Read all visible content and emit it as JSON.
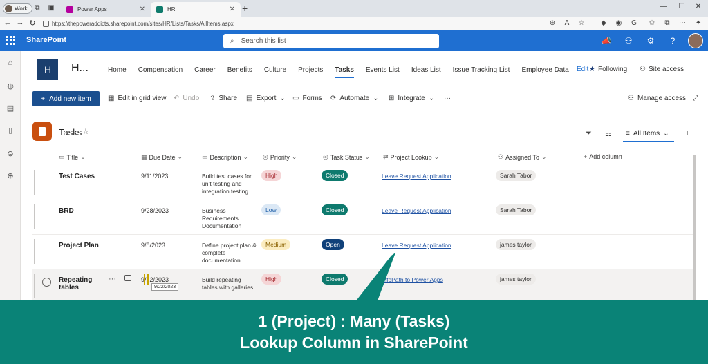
{
  "browser": {
    "profile_label": "Work",
    "tabs": [
      {
        "label": "Power Apps",
        "color": "#b4009e"
      },
      {
        "label": "HR",
        "color": "#0f7b6c"
      }
    ],
    "url": "https://thepoweraddicts.sharepoint.com/sites/HR/Lists/Tasks/AllItems.aspx"
  },
  "suite": {
    "app_name": "SharePoint",
    "search_placeholder": "Search this list"
  },
  "site": {
    "logo_letter": "H",
    "name": "H...",
    "nav": [
      "Home",
      "Compensation",
      "Career",
      "Benefits",
      "Culture",
      "Projects",
      "Tasks",
      "Events List",
      "Ideas List",
      "Issue Tracking List",
      "Employee Data",
      "···"
    ],
    "active_nav": "Tasks",
    "edit": "Edit",
    "following": "Following",
    "site_access": "Site access"
  },
  "commands": {
    "add_new_item": "Add new item",
    "edit_grid": "Edit in grid view",
    "undo": "Undo",
    "share": "Share",
    "export": "Export",
    "forms": "Forms",
    "automate": "Automate",
    "integrate": "Integrate",
    "more": "···",
    "manage_access": "Manage access"
  },
  "list": {
    "title": "Tasks",
    "view": "All Items",
    "columns": {
      "title": "Title",
      "due": "Due Date",
      "desc": "Description",
      "priority": "Priority",
      "status": "Task Status",
      "lookup": "Project Lookup",
      "assigned": "Assigned To",
      "add": "Add column"
    },
    "rows": [
      {
        "title": "Test Cases",
        "due": "9/11/2023",
        "desc": "Build test cases for unit testing and integration testing",
        "priority": "High",
        "status": "Closed",
        "lookup": "Leave Request Application",
        "assigned": "Sarah Tabor"
      },
      {
        "title": "BRD",
        "due": "9/28/2023",
        "desc": "Business Requirements Documentation",
        "priority": "Low",
        "status": "Closed",
        "lookup": "Leave Request Application",
        "assigned": "Sarah Tabor"
      },
      {
        "title": "Project Plan",
        "due": "9/8/2023",
        "desc": "Define project plan & complete documentation",
        "priority": "Medium",
        "status": "Open",
        "lookup": "Leave Request Application",
        "assigned": "james taylor"
      },
      {
        "title": "Repeating tables",
        "due": "9/22/2023",
        "desc": "Build repeating tables with galleries",
        "priority": "High",
        "status": "Closed",
        "lookup": "InfoPath to Power Apps",
        "assigned": "james taylor"
      }
    ],
    "tooltip": "9/22/2023"
  },
  "overlay": {
    "line1": "1 (Project) : Many (Tasks)",
    "line2": "Lookup Column in SharePoint"
  }
}
